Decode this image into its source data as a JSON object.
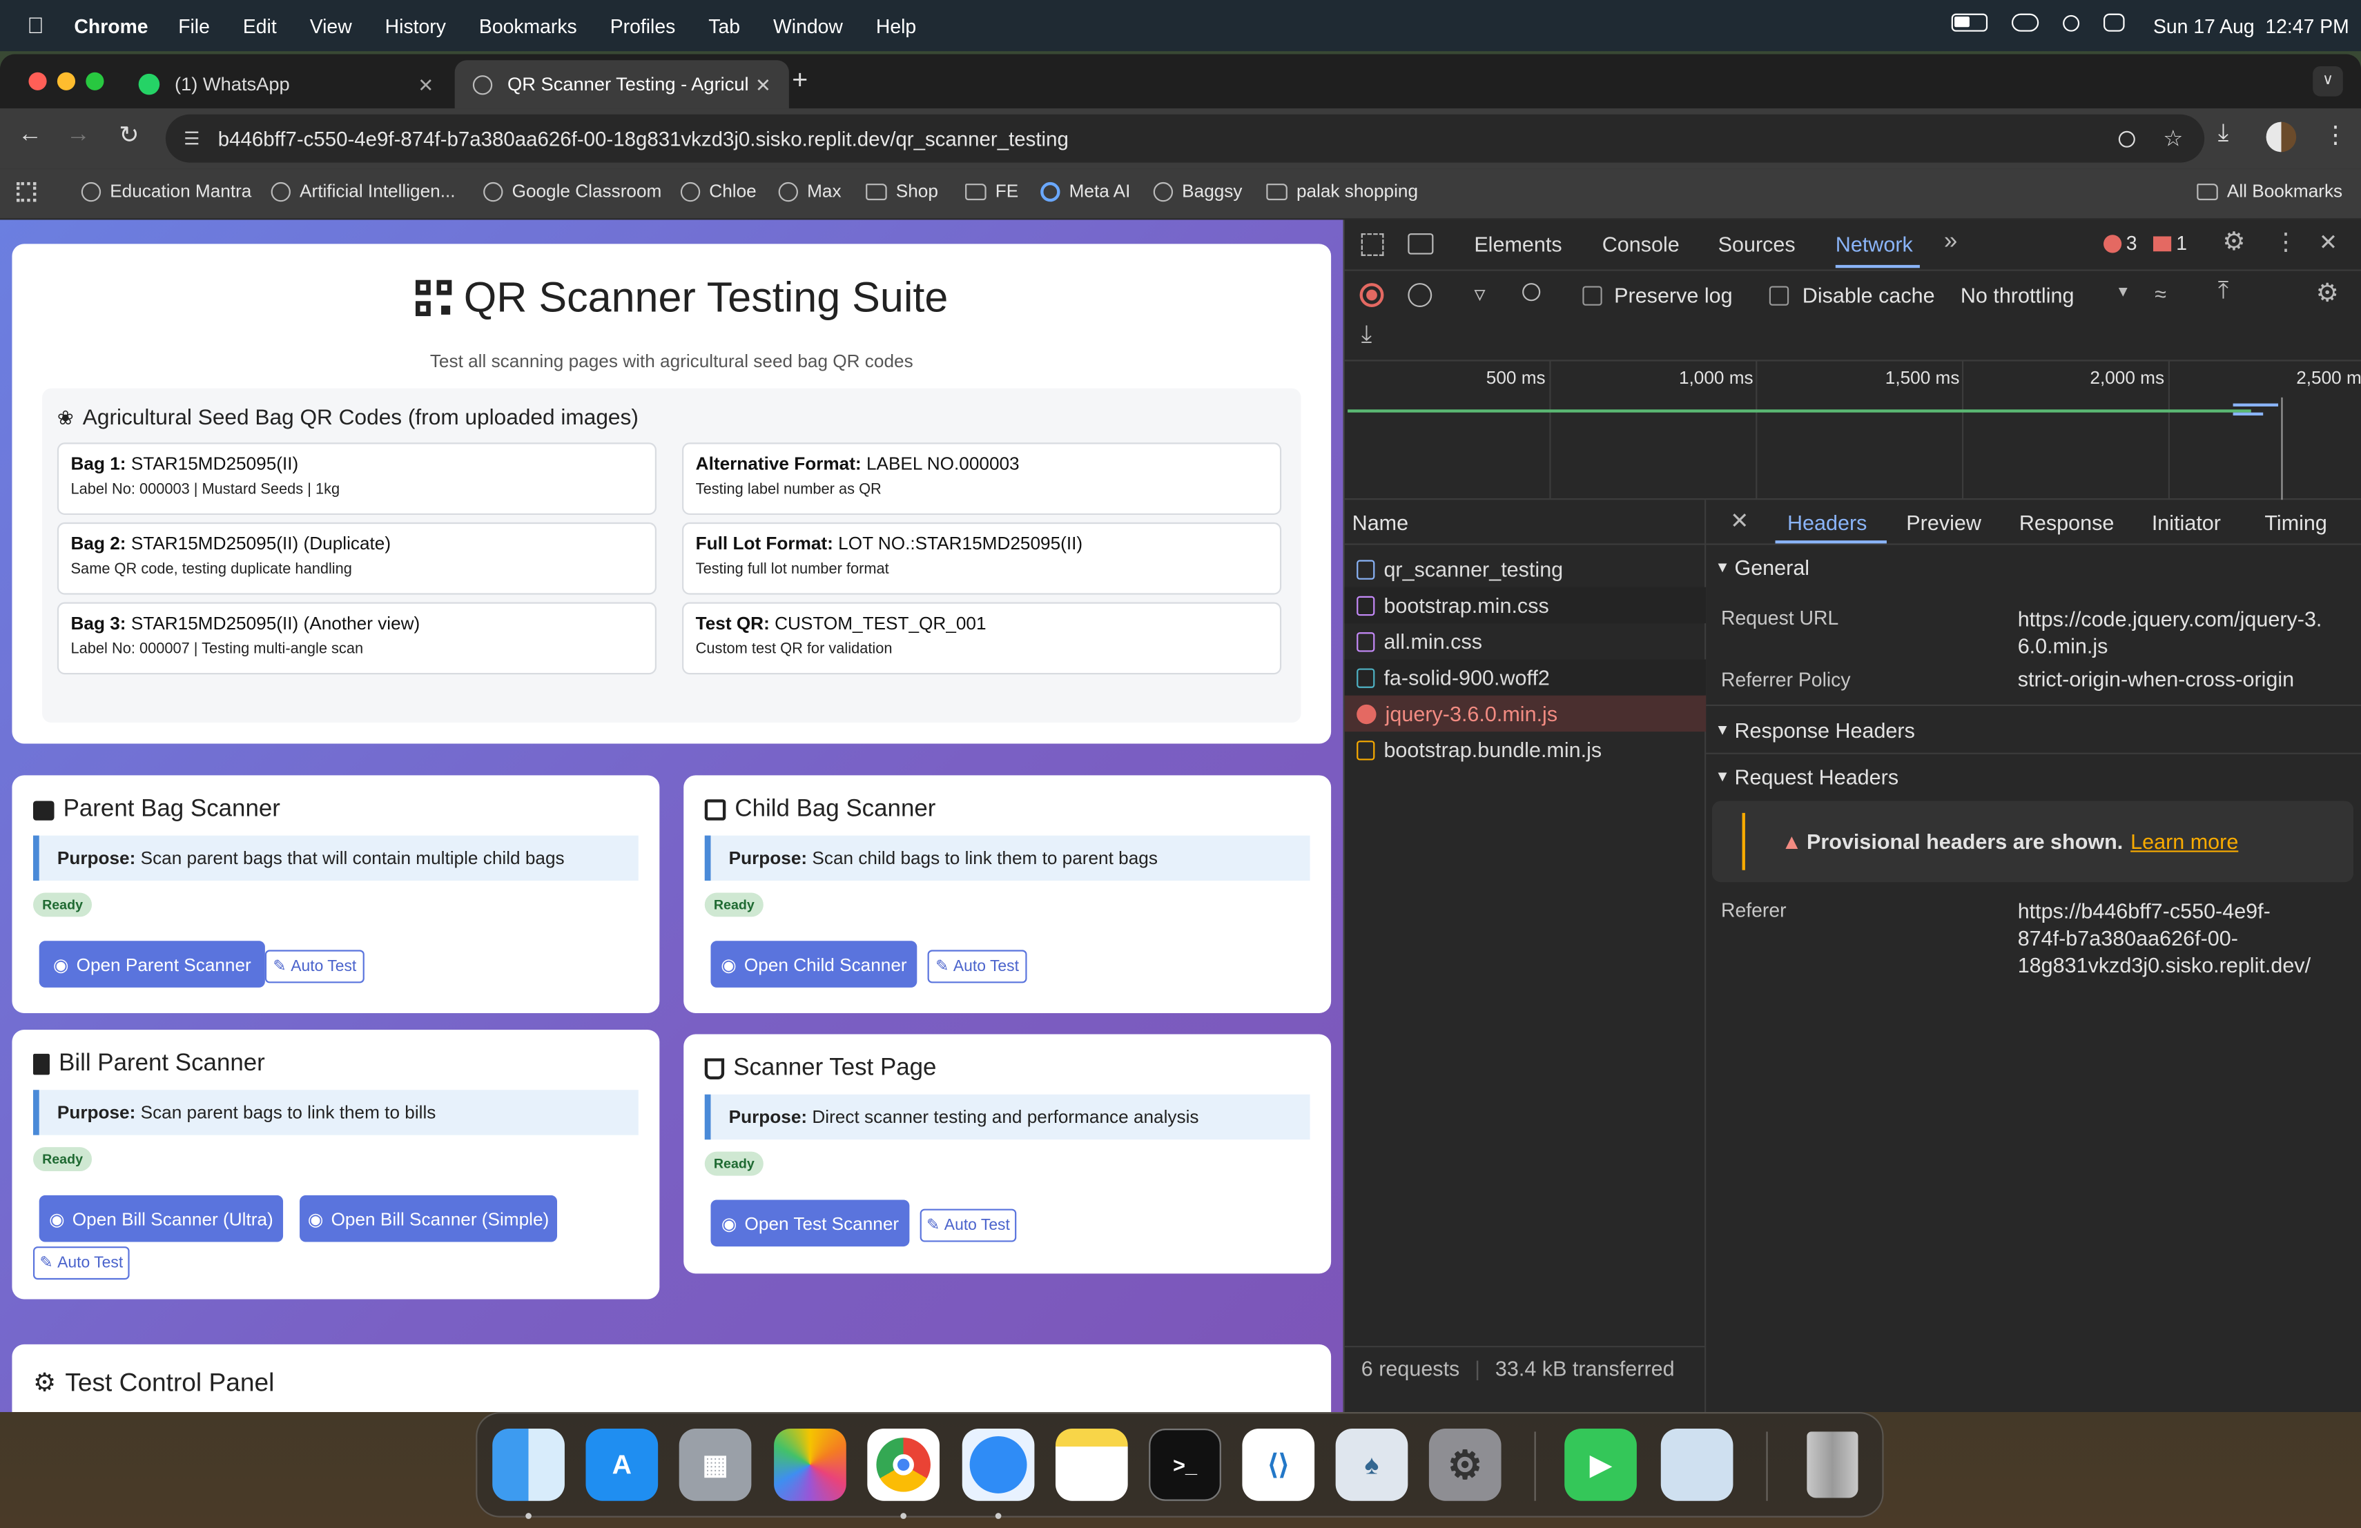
{
  "menubar": {
    "app": "Chrome",
    "items": [
      "File",
      "Edit",
      "View",
      "History",
      "Bookmarks",
      "Profiles",
      "Tab",
      "Window",
      "Help"
    ],
    "datetime": "Sun 17 Aug  12:47 PM"
  },
  "tabs": [
    {
      "label": "(1) WhatsApp"
    },
    {
      "label": "QR Scanner Testing - Agricult"
    }
  ],
  "url": "b446bff7-c550-4e9f-874f-b7a380aa626f-00-18g831vkzd3j0.sisko.replit.dev/qr_scanner_testing",
  "bookmarks": [
    "Education Mantra",
    "Artificial Intelligen...",
    "Google Classroom",
    "Chloe",
    "Max",
    "Shop",
    "FE",
    "Meta AI",
    "Baggsy",
    "palak shopping"
  ],
  "all_bookmarks": "All Bookmarks",
  "page": {
    "title": "QR Scanner Testing Suite",
    "subtitle": "Test all scanning pages with agricultural seed bag QR codes",
    "codes_heading": "Agricultural Seed Bag QR Codes (from uploaded images)",
    "bags": [
      {
        "label": "Bag 1:",
        "value": "STAR15MD25095(II)",
        "desc": "Label No: 000003 | Mustard Seeds | 1kg"
      },
      {
        "label": "Alternative Format:",
        "value": "LABEL NO.000003",
        "desc": "Testing label number as QR"
      },
      {
        "label": "Bag 2:",
        "value": "STAR15MD25095(II) (Duplicate)",
        "desc": "Same QR code, testing duplicate handling"
      },
      {
        "label": "Full Lot Format:",
        "value": "LOT NO.:STAR15MD25095(II)",
        "desc": "Testing full lot number format"
      },
      {
        "label": "Bag 3:",
        "value": "STAR15MD25095(II) (Another view)",
        "desc": "Label No: 000007 | Testing multi-angle scan"
      },
      {
        "label": "Test QR:",
        "value": "CUSTOM_TEST_QR_001",
        "desc": "Custom test QR for validation"
      }
    ],
    "purpose_label": "Purpose:",
    "ready": "Ready",
    "auto_test": "Auto Test",
    "scanners": {
      "parent": {
        "title": "Parent Bag Scanner",
        "purpose": "Scan parent bags that will contain multiple child bags",
        "button": "Open Parent Scanner"
      },
      "child": {
        "title": "Child Bag Scanner",
        "purpose": "Scan child bags to link them to parent bags",
        "button": "Open Child Scanner"
      },
      "bill": {
        "title": "Bill Parent Scanner",
        "purpose": "Scan parent bags to link them to bills",
        "button": "Open Bill Scanner (Ultra)",
        "button2": "Open Bill Scanner (Simple)"
      },
      "test": {
        "title": "Scanner Test Page",
        "purpose": "Direct scanner testing and performance analysis",
        "button": "Open Test Scanner"
      }
    },
    "control_panel": "Test Control Panel"
  },
  "devtools": {
    "tabs": [
      "Elements",
      "Console",
      "Sources",
      "Network"
    ],
    "errors": "3",
    "warnings": "1",
    "preserve_log": "Preserve log",
    "disable_cache": "Disable cache",
    "throttling": "No throttling",
    "timeline": [
      "500 ms",
      "1,000 ms",
      "1,500 ms",
      "2,000 ms",
      "2,500 m"
    ],
    "name_header": "Name",
    "requests": [
      "qr_scanner_testing",
      "bootstrap.min.css",
      "all.min.css",
      "fa-solid-900.woff2",
      "jquery-3.6.0.min.js",
      "bootstrap.bundle.min.js"
    ],
    "detail_tabs": [
      "Headers",
      "Preview",
      "Response",
      "Initiator",
      "Timing"
    ],
    "general": "General",
    "request_url_key": "Request URL",
    "request_url_lines": [
      "https://code.jquery.com/jquery-3.",
      "6.0.min.js"
    ],
    "referrer_policy_key": "Referrer Policy",
    "referrer_policy": "strict-origin-when-cross-origin",
    "response_headers": "Response Headers",
    "request_headers": "Request Headers",
    "provisional": "Provisional headers are shown.",
    "learn_more": "Learn more",
    "referer_key": "Referer",
    "referer_lines": [
      "https://b446bff7-c550-4e9f-",
      "874f-b7a380aa626f-00-",
      "18g831vkzd3j0.sisko.replit.dev/"
    ],
    "requests_count": "6 requests",
    "transferred": "33.4 kB transferred"
  },
  "colors": {
    "accent": "#5a74dd",
    "devtools_blue": "#8ab4f8",
    "error": "#e46962"
  }
}
